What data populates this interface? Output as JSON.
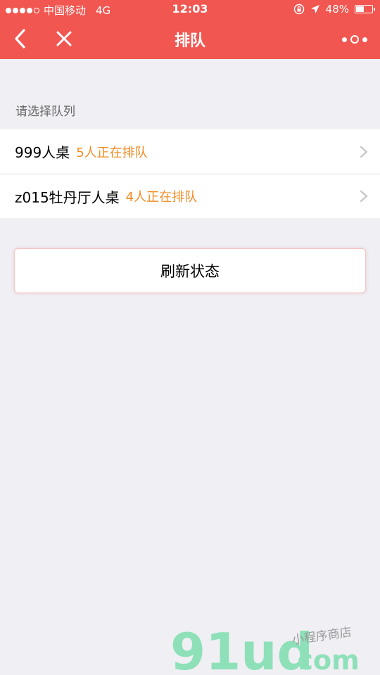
{
  "status_bar": {
    "carrier": "中国移动",
    "network": "4G",
    "time": "12:03",
    "battery_text": "48%",
    "battery_level": 0.48,
    "signal_filled": 4,
    "signal_total": 5
  },
  "nav": {
    "title": "排队",
    "back_icon": "chevron-left-icon",
    "close_icon": "close-icon",
    "more_icon": "more-dots-icon"
  },
  "main": {
    "section_label": "请选择队列",
    "queues": [
      {
        "name": "999人桌",
        "status": "5人正在排队"
      },
      {
        "name": "z015牡丹厅人桌",
        "status": "4人正在排队"
      }
    ],
    "refresh_label": "刷新状态"
  },
  "watermark": {
    "logo": "91ud",
    "domain": ".com",
    "tagline": "小程序商店"
  },
  "colors": {
    "brand": "#f15651",
    "accent_orange": "#f38c25",
    "background": "#efeff4",
    "watermark_green": "#8ee0b8"
  }
}
